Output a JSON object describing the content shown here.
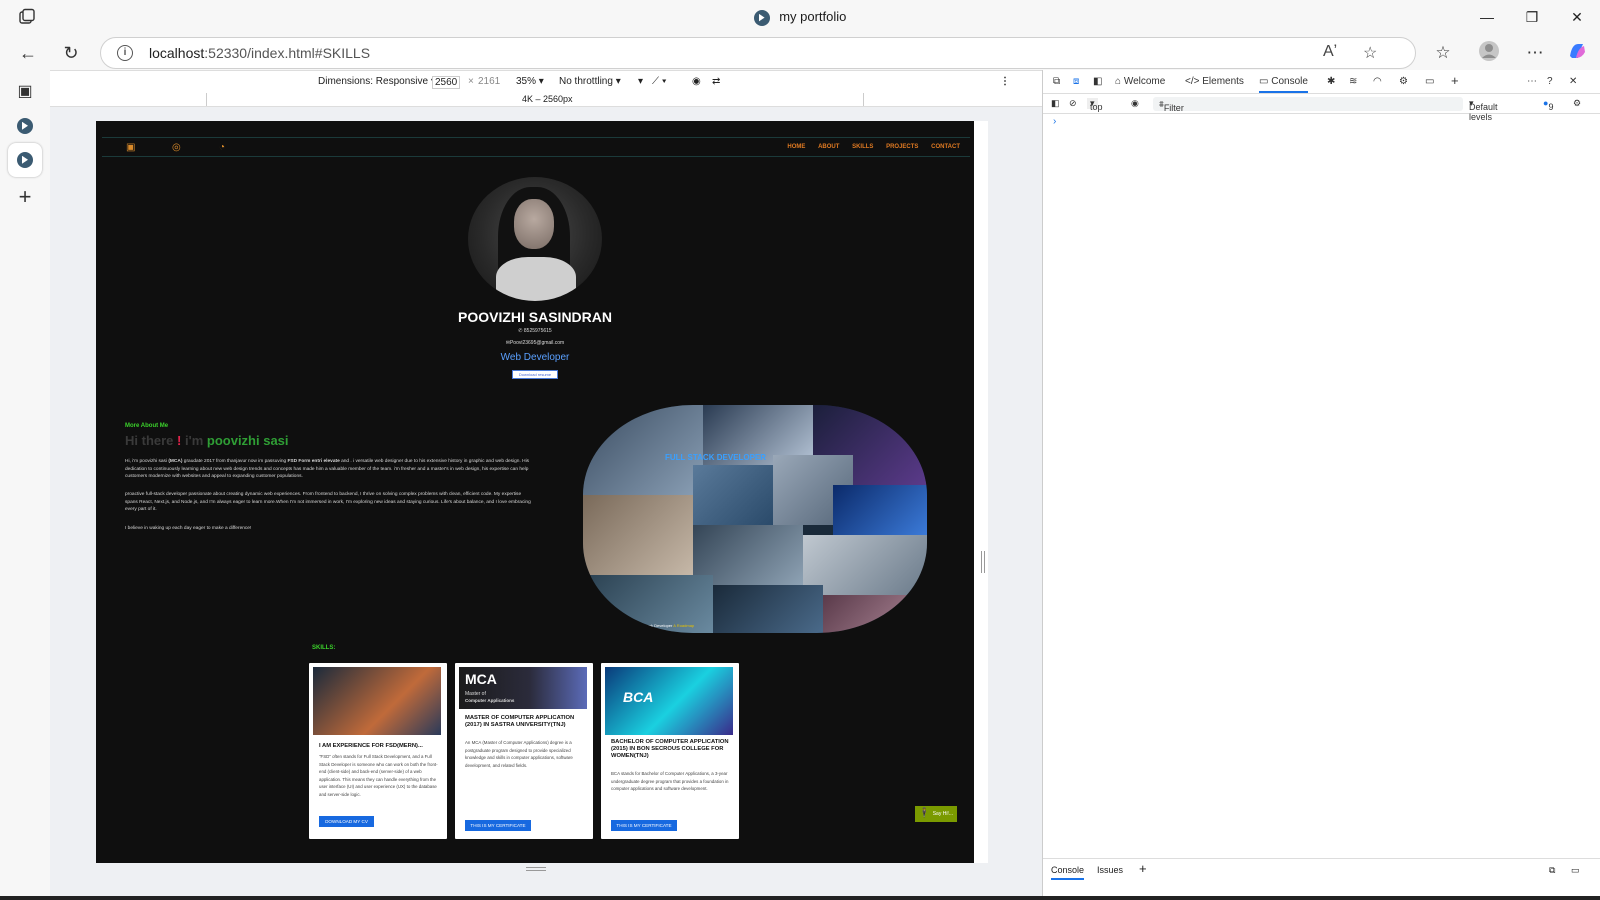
{
  "window": {
    "title": "my portfolio"
  },
  "address": {
    "host": "localhost",
    "rest": ":52330/index.html#SKILLS"
  },
  "device_toolbar": {
    "dimensions_label": "Dimensions: Responsive",
    "width": "2560",
    "height": "2161",
    "zoom": "35%",
    "throttling": "No throttling",
    "media_label": "4K – 2560px"
  },
  "portfolio": {
    "nav_links": [
      "HOME",
      "ABOUT",
      "SKILLS",
      "PROJECTS",
      "CONTACT"
    ],
    "name": "POOVIZHI SASINDRAN",
    "phone": "8525975615",
    "email": "Poovi23695@gmail.com",
    "role": "Web Developer",
    "download_resume": "Download resume",
    "more_about": "More About Me",
    "hi_prefix": "Hi there",
    "hi_excl": "!",
    "hi_im": "i'm",
    "hi_name": "poovizhi sasi",
    "about_p1_a": "Hi, i'm poovizhi sasi ",
    "about_p1_b": "(MCA)",
    "about_p1_c": " graudate 2017 from thanjavur now im passuving ",
    "about_p1_d": "FSD Form entri elevate",
    "about_p1_e": " and . i versatile web designer due to his extensive history in graphic and web design. His dedication to continuously learning about new web design trends and concepts has made him a valuable member of the team. i'm fresher and a master's in web design, his expertise can help customers modernize with websites and appeal to expanding customer populations.",
    "about_p2": "proactive full-stack developer passionate about creating dynamic web experiences. From frontend to backend, I thrive on solving complex problems with clean, efficient code. My expertise spans React, Next.js, and Node.js, and I'm always eager to learn more.When I'm not immersed in work, I'm exploring new ideas and staying curious. Life's about balance, and I love embracing every part of it.",
    "about_p3": "I believe in waking up each day eager to make a difference!",
    "collage_title": "FULL STACK DEVELOPER",
    "collage_caption_a": "Stack Developer",
    "collage_caption_b": "A Roadmap",
    "skills_label": "SKILLS:",
    "cards": [
      {
        "title": "I AM EXPERIENCE FOR FSD(MERN)...",
        "body": "\"FSD\" often stands for Full Stack Development, and a Full Stack Developer is someone who can work on both the front-end (client-side) and back-end (server-side) of a web application. This means they can handle everything from the user interface (UI) and user experience (UX) to the database and server-side logic.",
        "button": "DOWNLOAD MY CV"
      },
      {
        "img_title": "MCA",
        "img_sub": "Master of",
        "img_sub2": "Computer Applications",
        "title": "MASTER OF COMPUTER APPLICATION (2017) IN SASTRA UNIVERSITY(TNJ)",
        "body": "An MCA (Master of Computer Applications) degree is a postgraduate program designed to provide specialized knowledge and skills in computer applications, software development, and related fields.",
        "button": "THIS IS MY CERTIFICATE"
      },
      {
        "img_title": "BCA",
        "title": "BACHELOR OF COMPUTER APPLICATION (2015) IN BON SECROUS COLLEGE FOR WOMEN(TNJ)",
        "body": "BCA stands for Bachelor of Computer Applications, a 3-year undergraduate degree program that provides a foundation in computer applications and software development.",
        "button": "THIS IS MY CERTIFICATE"
      }
    ],
    "say_hi": "Say Hi!..."
  },
  "devtools": {
    "tabs": [
      "Welcome",
      "Elements",
      "Console"
    ],
    "context": "top",
    "filter_placeholder": "Filter",
    "levels": "Default levels",
    "issues_count": "9",
    "prompt": "›",
    "drawer_tabs": [
      "Console",
      "Issues"
    ]
  },
  "colors": {
    "accent": "#1a73e8",
    "nav_orange": "#e07a22",
    "green": "#3bd12b"
  }
}
